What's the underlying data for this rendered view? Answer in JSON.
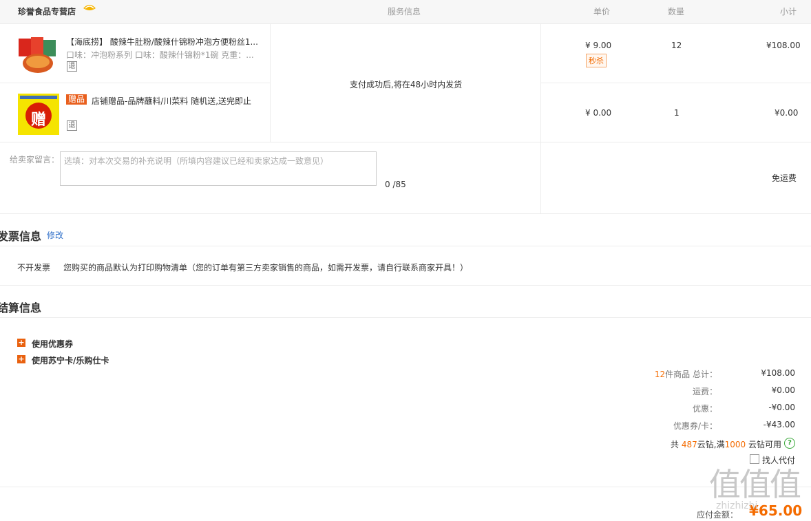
{
  "header": {
    "store_name": "珍誉食品专营店",
    "col_service": "服务信息",
    "col_price": "单价",
    "col_qty": "数量",
    "col_subtotal": "小计"
  },
  "items": [
    {
      "name": "【海底捞】 酸辣牛肚粉/酸辣什锦粉冲泡方便粉丝1...",
      "attrs": "口味：冲泡粉系列   口味：酸辣什锦粉*1碗   克重：...",
      "return_badge": "退",
      "price": "¥ 9.00",
      "promo_tag": "秒杀",
      "qty": "12",
      "subtotal": "¥108.00"
    },
    {
      "gift_tag": "赠品",
      "name": "店铺赠品-品牌蘸料/川菜料 随机送,送完即止",
      "return_badge": "退",
      "thumb_char": "赠",
      "price": "¥ 0.00",
      "qty": "1",
      "subtotal": "¥0.00"
    }
  ],
  "service_info": "支付成功后,将在48小时内发货",
  "message": {
    "label": "给卖家留言：",
    "placeholder": "选填：对本次交易的补充说明（所填内容建议已经和卖家达成一致意见）",
    "counter": "0 /85"
  },
  "shipping": "免运费",
  "invoice": {
    "title": "发票信息",
    "edit": "修改",
    "type": "不开发票",
    "note": "您购买的商品默认为打印购物清单（您的订单有第三方卖家销售的商品，如需开发票，请自行联系商家开具！）"
  },
  "settlement": {
    "title": "结算信息",
    "use_coupon": "使用优惠券",
    "use_card": "使用苏宁卡/乐购仕卡",
    "count_num": "12",
    "count_suffix": "件商品 总计：",
    "total": "¥108.00",
    "freight_label": "运费：",
    "freight": "¥0.00",
    "discount_label": "优惠：",
    "discount": "-¥0.00",
    "coupon_label": "优惠券/卡：",
    "coupon": "-¥43.00",
    "yunzuan_prefix": "共",
    "yunzuan_have": "487",
    "yunzuan_mid": "云钻,满",
    "yunzuan_need": "1000",
    "yunzuan_suffix": "云钻可用",
    "proxy_pay": "找人代付",
    "payable_label": "应付金额：",
    "payable": "¥65.00"
  },
  "watermark": "值值值",
  "watermark_url": "zhizhizhi",
  "colors": {
    "accent": "#f46b00",
    "link": "#2f6fc9",
    "gift": "#e95f1d"
  }
}
